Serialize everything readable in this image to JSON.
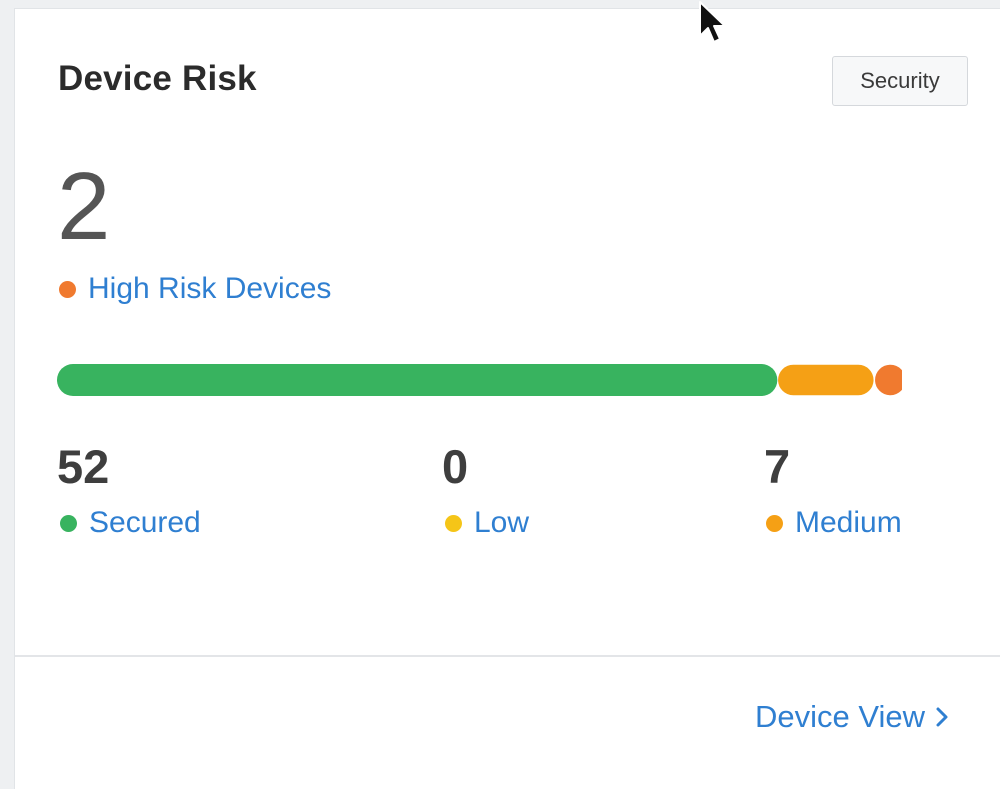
{
  "card": {
    "title": "Device Risk",
    "tag_button": "Security",
    "high_risk": {
      "count": "2",
      "label": "High Risk Devices",
      "color": "#f07a2f"
    },
    "risk_bar": {
      "segments": [
        {
          "name": "Secured",
          "value": 52,
          "color": "#38b35f"
        },
        {
          "name": "Low",
          "value": 0,
          "color": "#f5c518"
        },
        {
          "name": "Medium",
          "value": 7,
          "color": "#f5a015"
        },
        {
          "name": "High",
          "value": 2,
          "color": "#f07a2f"
        }
      ]
    },
    "stats": [
      {
        "value": "52",
        "label": "Secured",
        "color": "#38b35f"
      },
      {
        "value": "0",
        "label": "Low",
        "color": "#f5c518"
      },
      {
        "value": "7",
        "label": "Medium",
        "color": "#f5a015"
      }
    ],
    "footer_link": "Device View",
    "icons": {
      "chevron": "chevron-right-icon",
      "cursor": "mouse-pointer-icon"
    }
  }
}
